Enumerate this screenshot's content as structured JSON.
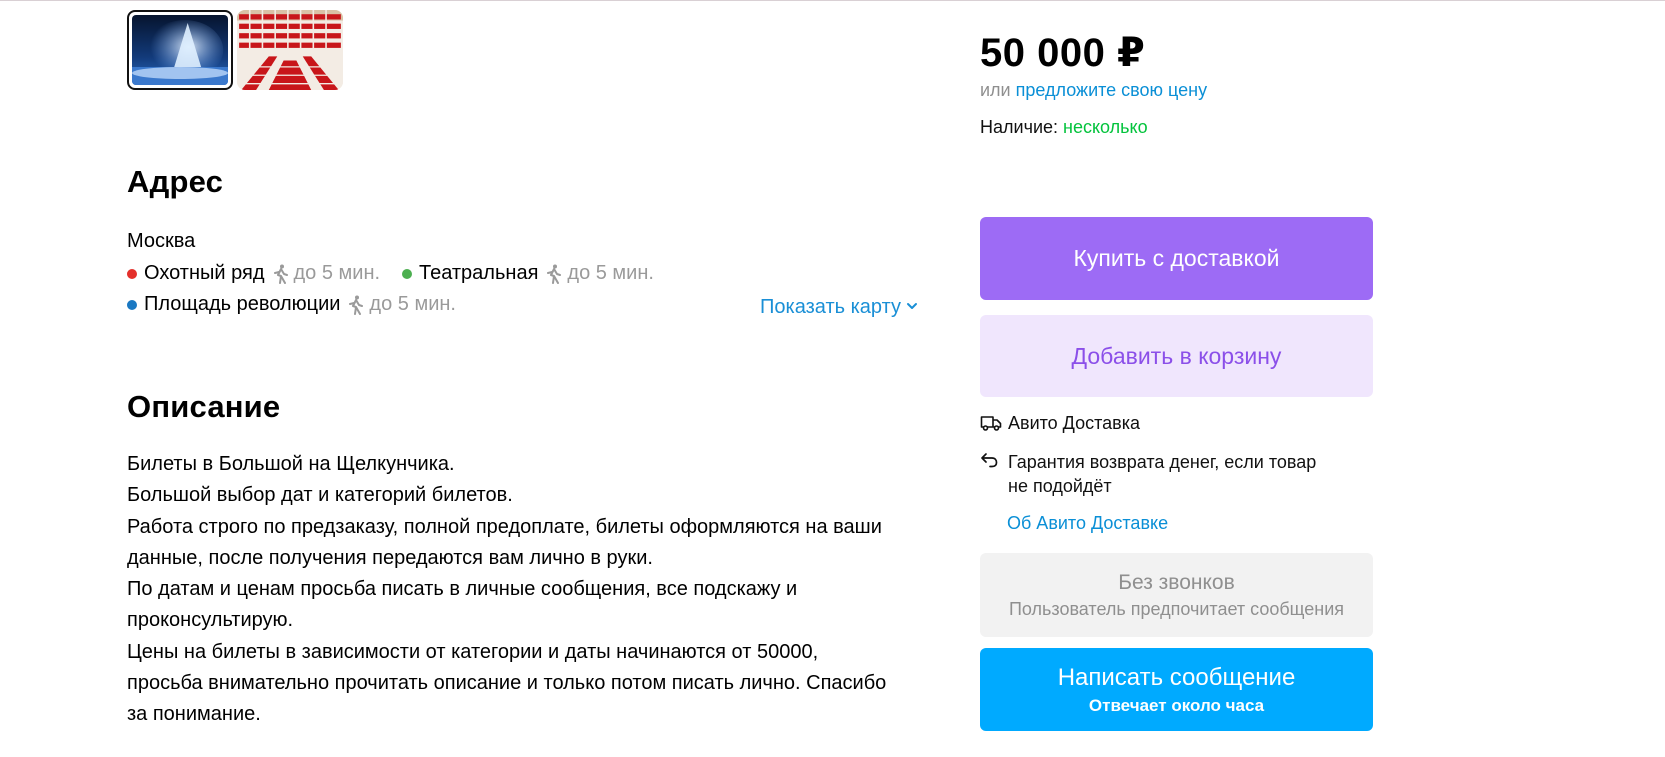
{
  "gallery": {
    "thumbnails": [
      {
        "alt": "christmas-tree-stage-photo",
        "active": true
      },
      {
        "alt": "theatre-hall-seating-photo",
        "active": false
      }
    ]
  },
  "address": {
    "heading": "Адрес",
    "city": "Москва",
    "metro": [
      {
        "name": "Охотный ряд",
        "walk": "до 5 мин.",
        "color": "#e4302b"
      },
      {
        "name": "Театральная",
        "walk": "до 5 мин.",
        "color": "#4caf50"
      },
      {
        "name": "Площадь революции",
        "walk": "до 5 мин.",
        "color": "#1a78c2"
      }
    ],
    "show_map": "Показать карту"
  },
  "description": {
    "heading": "Описание",
    "lines": [
      "Билеты в Большой на Щелкунчика.",
      "Большой выбор дат и категорий билетов.",
      "Работа строго по предзаказу, полной предоплате, билеты оформляются на ваши",
      "данные, после получения передаются вам лично в руки.",
      "По датам и ценам просьба писать в личные сообщения, все подскажу и",
      "проконсультирую.",
      "Цены на билеты в зависимости от категории и даты начинаются от 50000,",
      "просьба внимательно прочитать описание и только потом писать лично. Спасибо",
      "за понимание."
    ]
  },
  "offer": {
    "price": "50 000 ₽",
    "or": "или",
    "suggest_price": "предложите свою цену",
    "availability_label": "Наличие:",
    "availability_value": "несколько"
  },
  "actions": {
    "buy_delivery": "Купить с доставкой",
    "add_to_cart": "Добавить в корзину"
  },
  "delivery": {
    "service": "Авито Доставка",
    "guarantee_line1": "Гарантия возврата денег, если товар",
    "guarantee_line2": "не подойдёт",
    "about_link": "Об Авито Доставке"
  },
  "contact": {
    "no_calls_title": "Без звонков",
    "no_calls_subtitle": "Пользователь предпочитает сообщения",
    "message_button": "Написать сообщение",
    "message_subtitle": "Отвечает около часа"
  },
  "colors": {
    "accent_purple": "#9d6bf5",
    "light_purple": "#f0e6fd",
    "link_blue": "#0a8fd6",
    "message_blue": "#00aaff",
    "available_green": "#03c33c"
  }
}
